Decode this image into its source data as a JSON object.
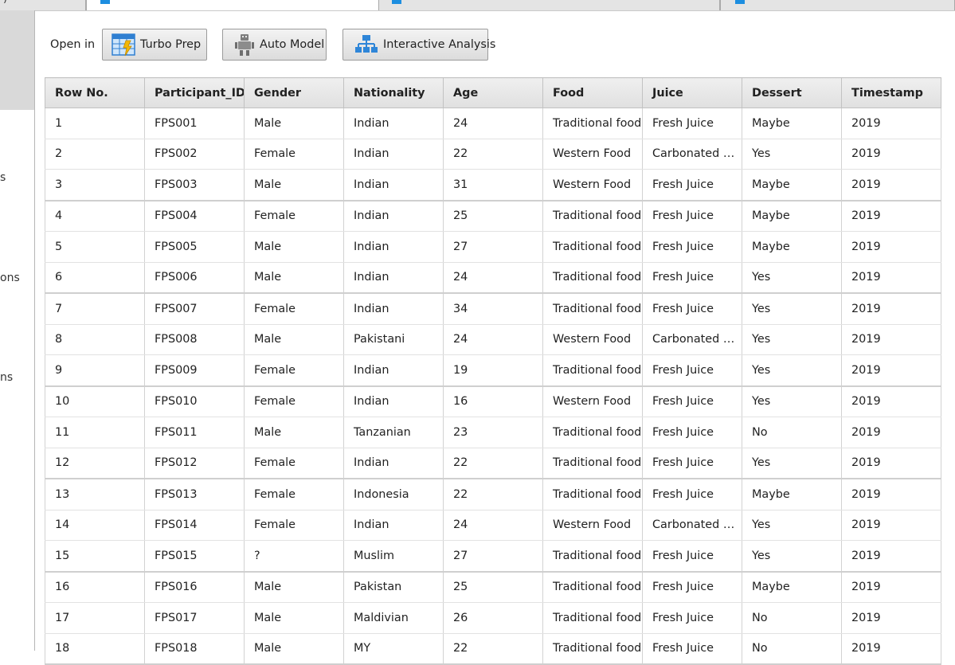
{
  "tabs": [
    {
      "label": ")"
    },
    {
      "label": ""
    },
    {
      "label": ""
    },
    {
      "label": ""
    }
  ],
  "sidebar": {
    "items": [
      {
        "label": "s"
      },
      {
        "label": "ons"
      },
      {
        "label": "ns"
      }
    ]
  },
  "toolbar": {
    "open_in_label": "Open in",
    "turbo_prep_label": "Turbo Prep",
    "auto_model_label": "Auto Model",
    "interactive_analysis_label": "Interactive Analysis"
  },
  "table": {
    "columns": [
      "Row No.",
      "Participant_ID",
      "Gender",
      "Nationality",
      "Age",
      "Food",
      "Juice",
      "Dessert",
      "Timestamp"
    ],
    "rows": [
      [
        "1",
        "FPS001",
        "Male",
        "Indian",
        "24",
        "Traditional food",
        "Fresh Juice",
        "Maybe",
        "2019"
      ],
      [
        "2",
        "FPS002",
        "Female",
        "Indian",
        "22",
        "Western Food",
        "Carbonated dri...",
        "Yes",
        "2019"
      ],
      [
        "3",
        "FPS003",
        "Male",
        "Indian",
        "31",
        "Western Food",
        "Fresh Juice",
        "Maybe",
        "2019"
      ],
      [
        "4",
        "FPS004",
        "Female",
        "Indian",
        "25",
        "Traditional food",
        "Fresh Juice",
        "Maybe",
        "2019"
      ],
      [
        "5",
        "FPS005",
        "Male",
        "Indian",
        "27",
        "Traditional food",
        "Fresh Juice",
        "Maybe",
        "2019"
      ],
      [
        "6",
        "FPS006",
        "Male",
        "Indian",
        "24",
        "Traditional food",
        "Fresh Juice",
        "Yes",
        "2019"
      ],
      [
        "7",
        "FPS007",
        "Female",
        "Indian",
        "34",
        "Traditional food",
        "Fresh Juice",
        "Yes",
        "2019"
      ],
      [
        "8",
        "FPS008",
        "Male",
        "Pakistani",
        "24",
        "Western Food",
        "Carbonated dri...",
        "Yes",
        "2019"
      ],
      [
        "9",
        "FPS009",
        "Female",
        "Indian",
        "19",
        "Traditional food",
        "Fresh Juice",
        "Yes",
        "2019"
      ],
      [
        "10",
        "FPS010",
        "Female",
        "Indian",
        "16",
        "Western Food",
        "Fresh Juice",
        "Yes",
        "2019"
      ],
      [
        "11",
        "FPS011",
        "Male",
        "Tanzanian",
        "23",
        "Traditional food",
        "Fresh Juice",
        "No",
        "2019"
      ],
      [
        "12",
        "FPS012",
        "Female",
        "Indian",
        "22",
        "Traditional food",
        "Fresh Juice",
        "Yes",
        "2019"
      ],
      [
        "13",
        "FPS013",
        "Female",
        "Indonesia",
        "22",
        "Traditional food",
        "Fresh Juice",
        "Maybe",
        "2019"
      ],
      [
        "14",
        "FPS014",
        "Female",
        "Indian",
        "24",
        "Western Food",
        "Carbonated dri...",
        "Yes",
        "2019"
      ],
      [
        "15",
        "FPS015",
        "?",
        "Muslim",
        "27",
        "Traditional food",
        "Fresh Juice",
        "Yes",
        "2019"
      ],
      [
        "16",
        "FPS016",
        "Male",
        "Pakistan",
        "25",
        "Traditional food",
        "Fresh Juice",
        "Maybe",
        "2019"
      ],
      [
        "17",
        "FPS017",
        "Male",
        "Maldivian",
        "26",
        "Traditional food",
        "Fresh Juice",
        "No",
        "2019"
      ],
      [
        "18",
        "FPS018",
        "Male",
        "MY",
        "22",
        "Traditional food",
        "Fresh Juice",
        "No",
        "2019"
      ]
    ]
  },
  "colors": {
    "accent_blue": "#1d8ee0",
    "header_bg": "#e6e6e6",
    "sidebar_selected": "#d9d9d9"
  },
  "icons": {
    "turbo_prep": "turbo-prep-icon",
    "auto_model": "robot-icon",
    "interactive_analysis": "hierarchy-icon"
  }
}
